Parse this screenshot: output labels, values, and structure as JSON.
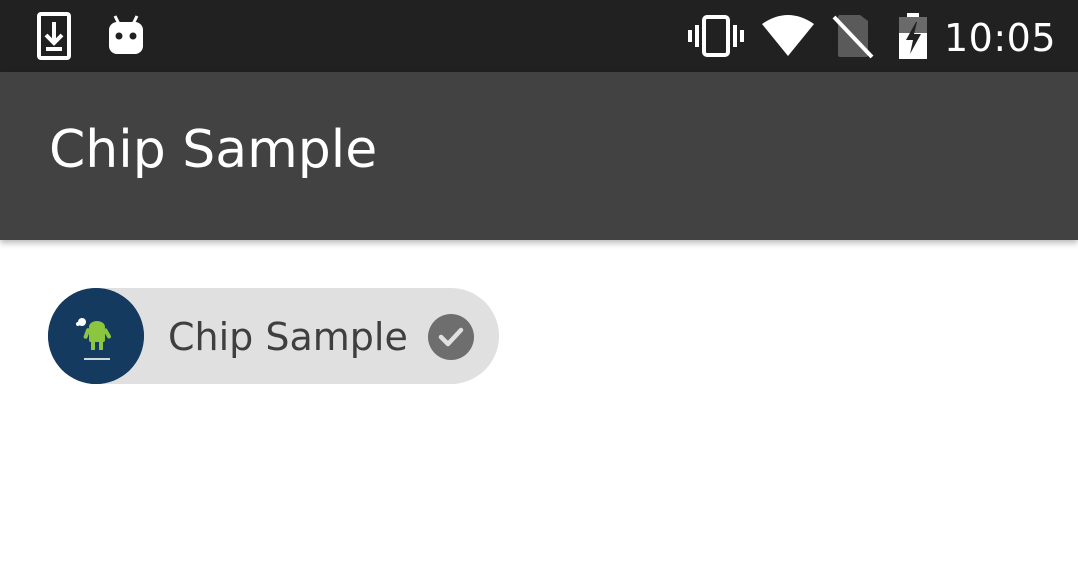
{
  "status_bar": {
    "time": "10:05",
    "icons": [
      "download-notification-icon",
      "android-debug-icon",
      "vibrate-icon",
      "wifi-icon",
      "no-sim-icon",
      "battery-charging-icon"
    ],
    "icon_color": "#ffffff",
    "background": "#212121"
  },
  "app_bar": {
    "title": "Chip Sample",
    "background": "#424242"
  },
  "chip": {
    "label": "Chip Sample",
    "avatar_icon": "android-avatar-icon",
    "close_icon": "check-circle-icon",
    "chip_background": "#e0e0e0",
    "avatar_background": "#153a5f"
  }
}
